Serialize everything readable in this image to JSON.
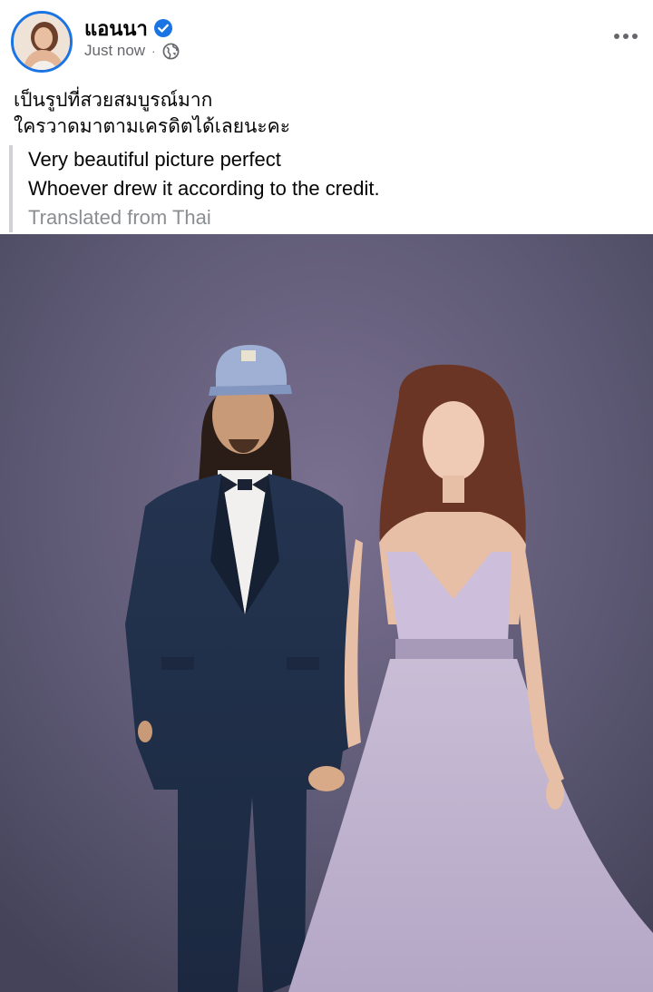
{
  "post": {
    "author": "แอนนา",
    "timestamp": "Just now",
    "separator": "·",
    "privacy_icon": "globe-icon",
    "verified_icon": "verified-badge-icon",
    "more_icon": "more-options-icon",
    "text_lines": [
      "เป็นรูปที่สวยสมบูรณ์มาก",
      "ใครวาดมาตามเครดิตได้เลยนะคะ"
    ],
    "translation_lines": [
      "Very beautiful picture perfect",
      "Whoever drew it according to the credit."
    ],
    "translation_note": "Translated from Thai"
  },
  "colors": {
    "accent": "#1b74e4",
    "secondary_text": "#65676b",
    "photo_background": "#55526a"
  }
}
